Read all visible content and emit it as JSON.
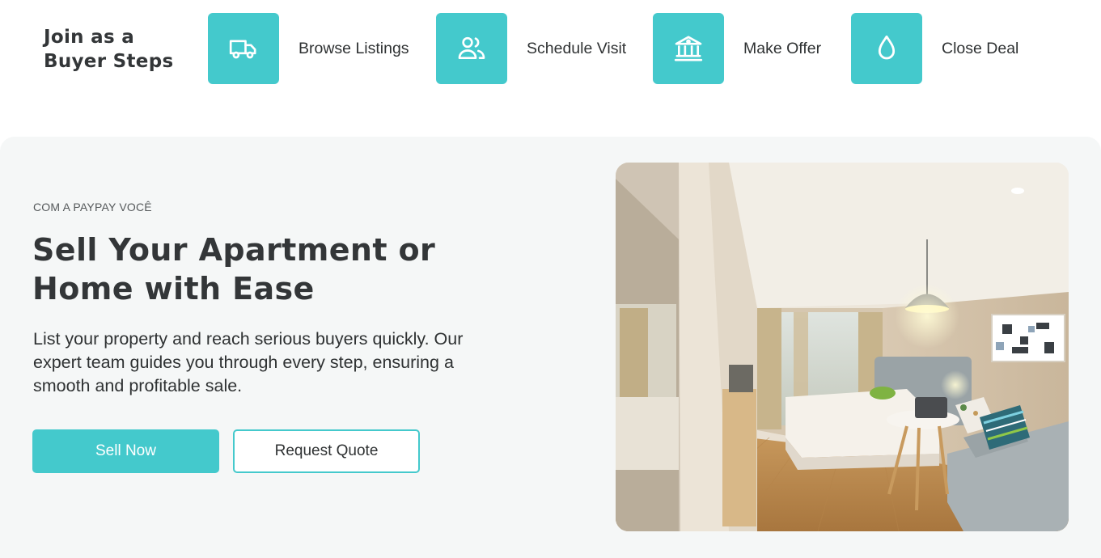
{
  "steps_section": {
    "title": "Join as a Buyer Steps",
    "steps": [
      {
        "label": "Browse Listings",
        "icon": "truck-icon"
      },
      {
        "label": "Schedule Visit",
        "icon": "users-icon"
      },
      {
        "label": "Make Offer",
        "icon": "bank-icon"
      },
      {
        "label": "Close Deal",
        "icon": "droplet-icon"
      }
    ]
  },
  "hero": {
    "eyebrow": "COM A PAYPAY VOCÊ",
    "title": "Sell Your Apartment or Home with Ease",
    "description": "List your property and reach serious buyers quickly. Our expert team guides you through every step, ensuring a smooth and profitable sale.",
    "primary_button": "Sell Now",
    "secondary_button": "Request Quote",
    "image_subject": "bedroom-photo"
  },
  "colors": {
    "accent": "#44c9cc",
    "hero_background": "#f5f7f7",
    "text": "#2f3233"
  }
}
